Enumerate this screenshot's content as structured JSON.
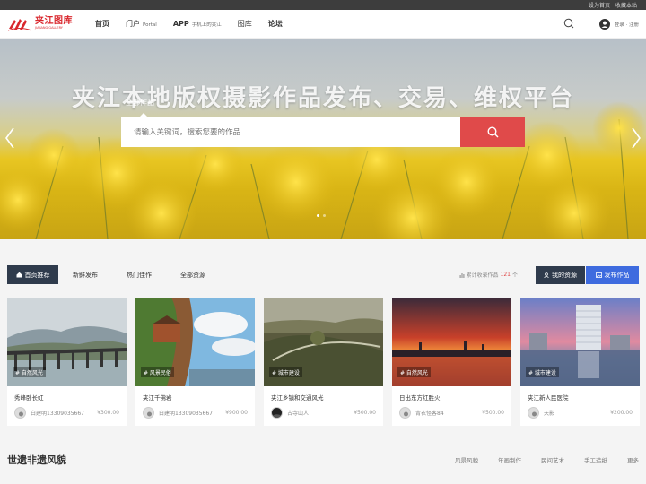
{
  "topbar": {
    "set_home": "设为首页",
    "bookmark": "收藏本站"
  },
  "logo": {
    "name": "夹江图库",
    "subtitle": "JIAJIANG GALLERY"
  },
  "nav": [
    {
      "label": "首页",
      "sub": ""
    },
    {
      "label": "门户",
      "sub": "Portal"
    },
    {
      "label": "APP",
      "sub": "手机上的夹江"
    },
    {
      "label": "图库",
      "sub": ""
    },
    {
      "label": "论坛",
      "sub": ""
    }
  ],
  "header_right": {
    "login": "登录",
    "separator": "·",
    "register": "注册"
  },
  "hero": {
    "title": "夹江本地版权摄影作品发布、交易、维权平台",
    "search_tab": "全部作品",
    "search_placeholder": "请输入关键词，搜索您要的作品"
  },
  "tabs": {
    "items": [
      "首页推荐",
      "新鲜发布",
      "热门佳作",
      "全部资源"
    ],
    "count_prefix": "累计收录作品",
    "count_value": "121",
    "count_suffix": "个",
    "my_resources": "我的资源",
    "publish": "发布作品"
  },
  "cards": [
    {
      "tag": "# 自然风光",
      "title": "秀峰卧长虹",
      "author": "白建明13309035667",
      "price": "¥300.00"
    },
    {
      "tag": "# 风景民俗",
      "title": "夹江千佛岩",
      "author": "白建明13309035667",
      "price": "¥900.00"
    },
    {
      "tag": "# 城市建设",
      "title": "夹江乡镇和交通风光",
      "author": "古寺山人",
      "price": "¥500.00"
    },
    {
      "tag": "# 自然风光",
      "title": "日出东方红胜火",
      "author": "青衣怪客84",
      "price": "¥500.00"
    },
    {
      "tag": "# 城市建设",
      "title": "夹江新人民医院",
      "author": "天影",
      "price": "¥200.00"
    }
  ],
  "section": {
    "title": "世遗非遗风貌",
    "links": [
      "风景风貌",
      "年画制作",
      "民间艺术",
      "手工造纸",
      "更多"
    ]
  }
}
